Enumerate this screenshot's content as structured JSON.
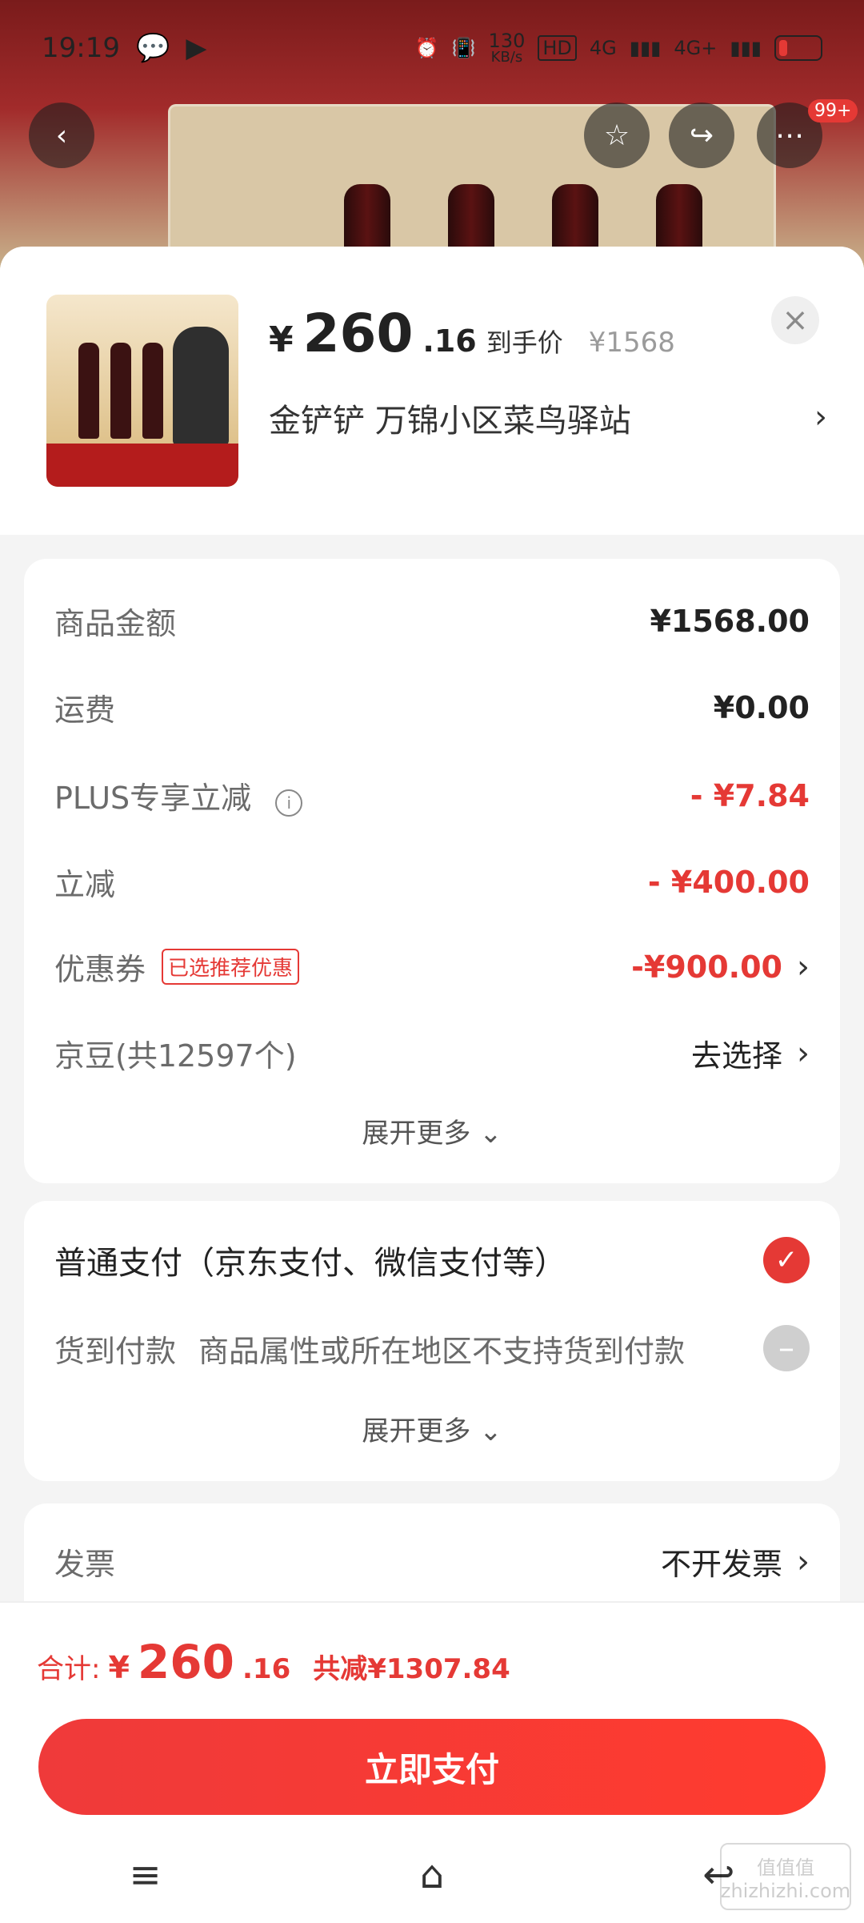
{
  "status": {
    "time": "19:19",
    "net_speed_value": "130",
    "net_speed_unit": "KB/s",
    "hd_label": "HD",
    "net_1": "4G",
    "net_2": "4G+"
  },
  "top_actions": {
    "badge": "99+"
  },
  "summary": {
    "yen": "¥",
    "price_big": "260",
    "price_small": ".16",
    "label": "到手价",
    "original": "¥1568",
    "address": "金铲铲  万锦小区菜鸟驿站",
    "chevron": "›"
  },
  "amounts": {
    "rows": [
      {
        "label": "商品金额",
        "value": "¥1568.00"
      },
      {
        "label": "运费",
        "value": "¥0.00"
      },
      {
        "label": "PLUS专享立减",
        "value": "- ¥7.84"
      },
      {
        "label": "立减",
        "value": "- ¥400.00"
      },
      {
        "label": "优惠券",
        "tag": "已选推荐优惠",
        "value": "-¥900.00"
      },
      {
        "label": "京豆(共12597个)",
        "value": "去选择"
      }
    ],
    "more": "展开更多 ⌄"
  },
  "payment": {
    "normal": "普通支付（京东支付、微信支付等）",
    "cod_label": "货到付款",
    "cod_desc": "商品属性或所在地区不支持货到付款",
    "more": "展开更多 ⌄"
  },
  "invoice": {
    "label": "发票",
    "value": "不开发票"
  },
  "footer": {
    "total_label": "合计:",
    "yen": "¥",
    "total_big": "260",
    "total_small": ".16",
    "reduce": "共减¥1307.84",
    "pay_button": "立即支付"
  },
  "watermark": {
    "text1": "值值值",
    "text2": "zhizhizhi.com"
  }
}
